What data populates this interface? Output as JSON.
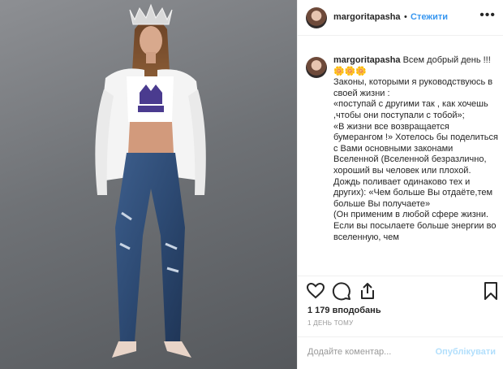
{
  "header": {
    "username": "margoritapasha",
    "separator": "•",
    "follow_label": "Стежити",
    "more_icon": "more-dots-icon"
  },
  "caption": {
    "username": "margoritapasha",
    "lines": [
      "Всем добрый день !!!🌼🌼🌼",
      "Законы, которыми я руководствуюсь в своей жизни :",
      "«поступай с другими так , как хочешь ,чтобы они поступали с тобой»;",
      "«В жизни все возвращается бумерангом !» Хотелось бы поделиться с Вами основными законами Вселенной (Вселенной безразлично, хороший вы человек или плохой. Дождь поливает одинаково тех и других): «Чем больше Вы отдаёте,тем больше Вы получаете»",
      "(Он применим в любой сфере жизни. Если вы посылаете больше энергии во вселенную, чем"
    ]
  },
  "actions": {
    "like_icon": "heart-icon",
    "comment_icon": "comment-icon",
    "share_icon": "share-icon",
    "save_icon": "bookmark-icon"
  },
  "likes_text": "1 179 вподобань",
  "time_text": "1 ДЕНЬ ТОМУ",
  "comment": {
    "placeholder": "Додайте коментар...",
    "post_label": "Опублікувати"
  },
  "colors": {
    "accent": "#3897f0",
    "muted": "#999999",
    "border": "#efefef"
  }
}
